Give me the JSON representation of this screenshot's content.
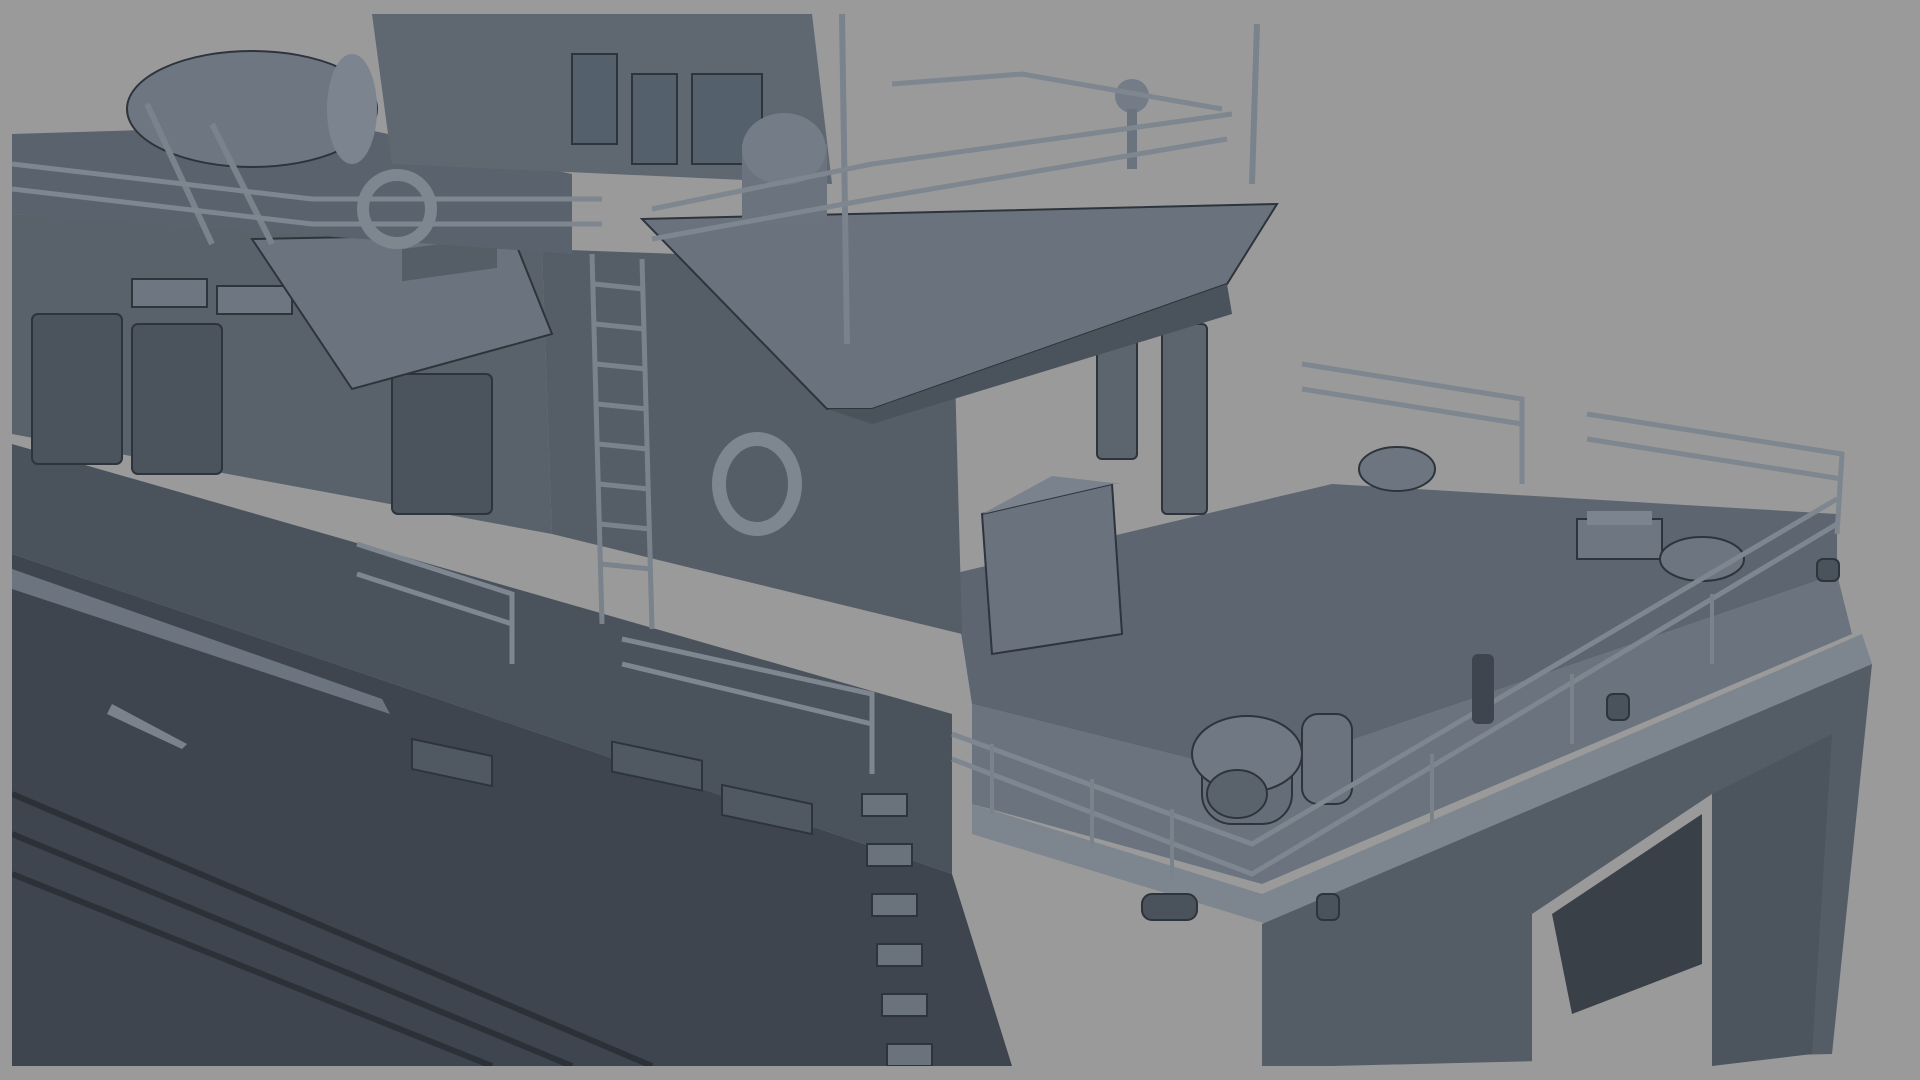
{
  "viewport": {
    "background_color": "#9a9a9a"
  },
  "render": {
    "subject": "patrol-boat-3d-model-clay-render",
    "palette": {
      "hull_dark": "#3c434c",
      "hull_mid": "#545c66",
      "hull_light": "#6d7580",
      "deck": "#5f6771",
      "superstructure": "#626a75",
      "highlight": "#8a929c",
      "line": "#2e343b"
    }
  }
}
